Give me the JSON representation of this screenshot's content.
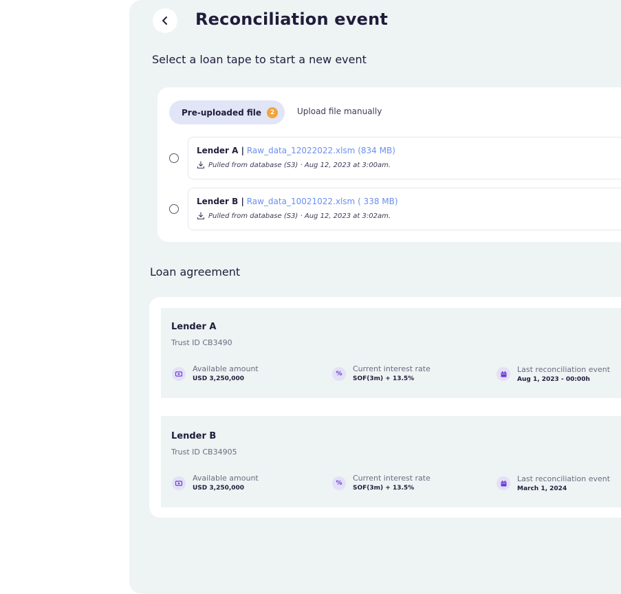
{
  "header": {
    "title": "Reconciliation event"
  },
  "loan_tape": {
    "heading": "Select a loan tape to start a new event",
    "tabs": {
      "preuploaded": "Pre-uploaded file",
      "preuploaded_count": "2",
      "manual": "Upload file manually"
    },
    "files": [
      {
        "lender": "Lender A |",
        "file_name": "Raw_data_12022022.xlsm",
        "size": "(834 MB)",
        "source": "Pulled from database (S3) · Aug 12, 2023 at 3:00am."
      },
      {
        "lender": "Lender B |",
        "file_name": "Raw_data_10021022.xlsm",
        "size": "( 338 MB)",
        "source": "Pulled from database (S3) · Aug 12, 2023 at 3:02am."
      }
    ]
  },
  "loan_agreement": {
    "heading": "Loan agreement",
    "lenders": [
      {
        "name": "Lender A",
        "trust_id": "Trust ID CB3490",
        "available_label": "Available amount",
        "available_value": "USD 3,250,000",
        "rate_label": "Current interest rate",
        "rate_value": "SOF(3m) + 13.5%",
        "last_label": "Last reconciliation event",
        "last_value": "Aug 1, 2023 - 00:00h"
      },
      {
        "name": "Lender B",
        "trust_id": "Trust ID CB34905",
        "available_label": "Available amount",
        "available_value": "USD 3,250,000",
        "rate_label": "Current interest rate",
        "rate_value": "SOF(3m) + 13.5%",
        "last_label": "Last reconciliation event",
        "last_value": "March 1, 2024"
      }
    ]
  },
  "colors": {
    "accent": "#6a3fd0",
    "link": "#6a8ff0",
    "badge": "#f2a33a",
    "panel": "#eef3f4"
  },
  "icons": [
    "chevron-left-icon",
    "download-icon",
    "money-icon",
    "percent-icon",
    "calendar-icon"
  ]
}
